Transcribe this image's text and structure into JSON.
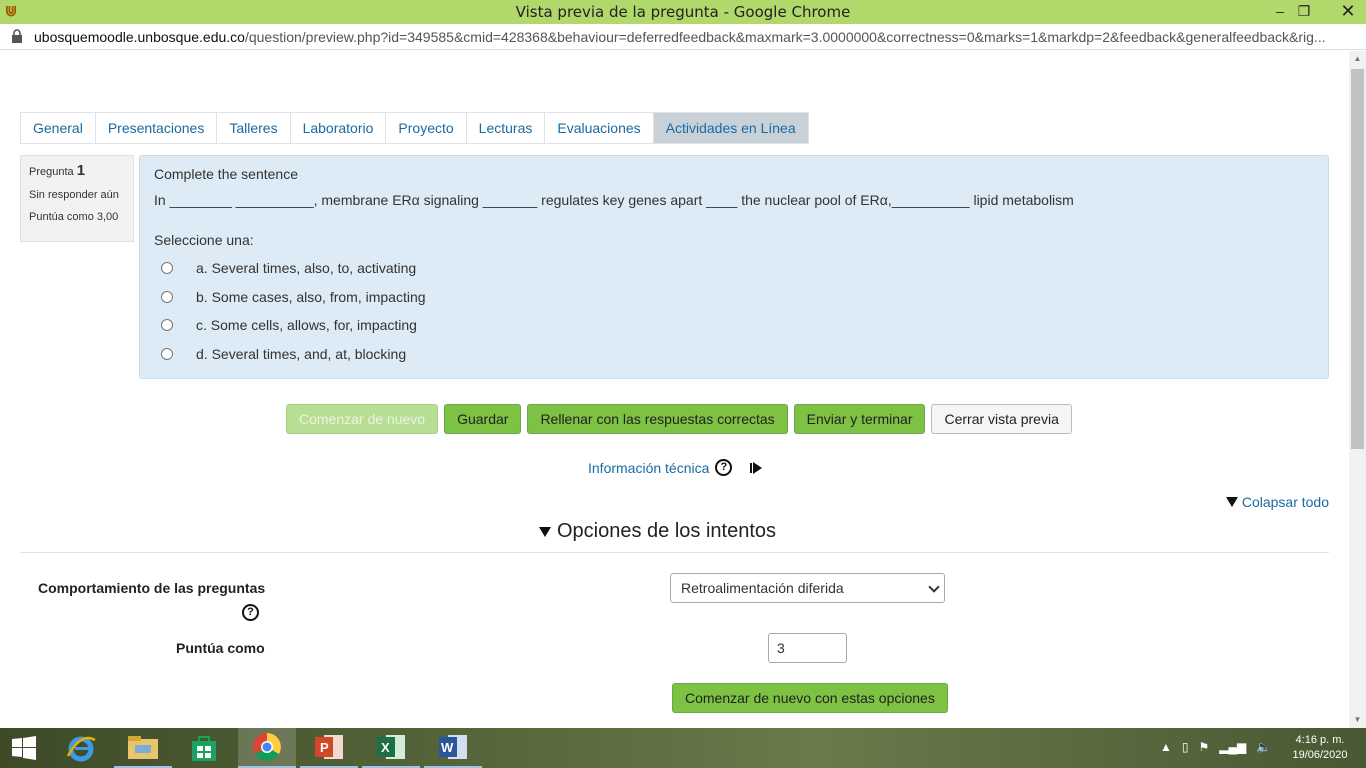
{
  "window": {
    "title": "Vista previa de la pregunta - Google Chrome",
    "minimize": "‒",
    "maximize": "❐",
    "close": "✕"
  },
  "address": {
    "host": "ubosquemoodle.unbosque.edu.co",
    "path": "/question/preview.php?id=349585&cmid=428368&behaviour=deferredfeedback&maxmark=3.0000000&correctness=0&marks=1&markdp=2&feedback&generalfeedback&rig..."
  },
  "tabs": [
    {
      "label": "General"
    },
    {
      "label": "Presentaciones"
    },
    {
      "label": "Talleres"
    },
    {
      "label": "Laboratorio"
    },
    {
      "label": "Proyecto"
    },
    {
      "label": "Lecturas"
    },
    {
      "label": "Evaluaciones"
    },
    {
      "label": "Actividades en Línea"
    }
  ],
  "question_info": {
    "label": "Pregunta",
    "number": "1",
    "state": "Sin responder aún",
    "grade": "Puntúa como 3,00"
  },
  "question": {
    "text1": "Complete the sentence",
    "text2": "In ________ __________, membrane ERα signaling _______ regulates key genes apart ____ the nuclear pool of ERα,__________ lipid metabolism",
    "prompt": "Seleccione una:",
    "options": [
      {
        "label": "a. Several times, also, to, activating"
      },
      {
        "label": "b. Some cases, also, from, impacting"
      },
      {
        "label": "c. Some cells, allows, for, impacting"
      },
      {
        "label": "d. Several times, and, at, blocking"
      }
    ]
  },
  "buttons": {
    "restart": "Comenzar de nuevo",
    "save": "Guardar",
    "fill": "Rellenar con las respuestas correctas",
    "submit": "Enviar y terminar",
    "close": "Cerrar vista previa"
  },
  "tech_info": "Información técnica",
  "collapse_all": "Colapsar todo",
  "attempt_options": {
    "title": "Opciones de los intentos",
    "behaviour_label": "Comportamiento de las preguntas",
    "behaviour_value": "Retroalimentación diferida",
    "mark_label": "Puntúa como",
    "mark_value": "3",
    "restart_with_options": "Comenzar de nuevo con estas opciones"
  },
  "taskbar": {
    "clock_time": "4:16 p. m.",
    "clock_date": "19/06/2020"
  },
  "colors": {
    "title_bar": "#b0d86a",
    "link": "#1a6aa3",
    "question_bg": "#dcebf5",
    "button_green": "#7dc242"
  }
}
